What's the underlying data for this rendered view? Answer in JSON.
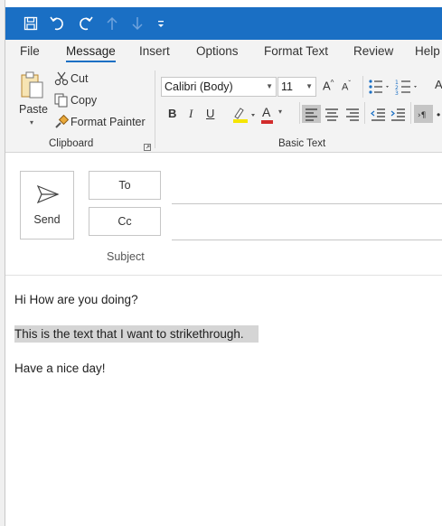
{
  "qat": {
    "icons": [
      "save-icon",
      "undo-icon",
      "redo-icon",
      "up-arrow-icon",
      "down-arrow-icon",
      "customize-qat-icon"
    ]
  },
  "tabs": [
    {
      "label": "File"
    },
    {
      "label": "Message"
    },
    {
      "label": "Insert"
    },
    {
      "label": "Options"
    },
    {
      "label": "Format Text"
    },
    {
      "label": "Review"
    },
    {
      "label": "Help"
    }
  ],
  "active_tab": "Message",
  "clipboard": {
    "paste": "Paste",
    "cut": "Cut",
    "copy": "Copy",
    "format_painter": "Format Painter",
    "group_label": "Clipboard"
  },
  "basic_text": {
    "font_name": "Calibri (Body)",
    "font_size": "11",
    "bold": "B",
    "italic": "I",
    "underline": "U",
    "font_color_letter": "A",
    "group_label": "Basic Text"
  },
  "colors": {
    "accent": "#1a6fc4",
    "highlight": "#f5e500",
    "font_color": "#d22c2c",
    "selection": "#d5d5d5"
  },
  "compose": {
    "send": "Send",
    "to": "To",
    "cc": "Cc",
    "subject": "Subject"
  },
  "message_body": {
    "line1": "Hi How are you doing?",
    "line2": "This is the text that I want to strikethrough.",
    "line3": "Have a nice day!"
  }
}
